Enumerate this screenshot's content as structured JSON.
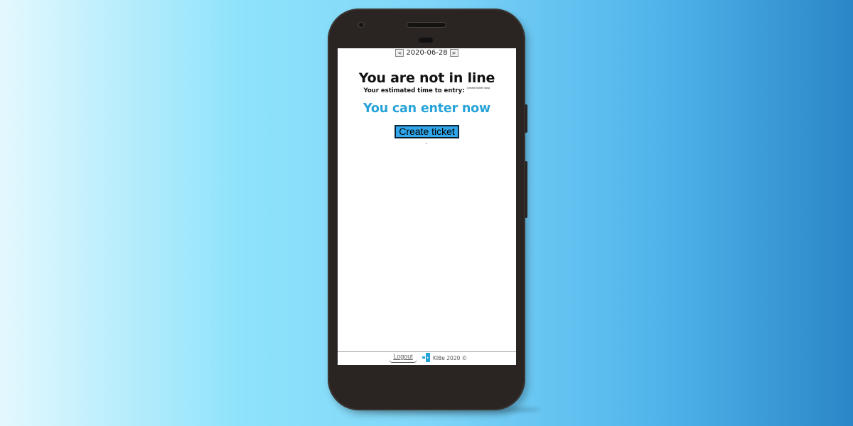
{
  "date_nav": {
    "prev_label": "<",
    "date": "2020-06-28",
    "next_label": ">"
  },
  "queue": {
    "heading": "You are not in line",
    "eta_label": "Your estimated time to entry:",
    "eta_note": "(create ticket now)",
    "status": "You can enter now",
    "create_button_label": "Create ticket"
  },
  "footer": {
    "logout_label": "Logout",
    "copyright": "KIBe 2020 ©"
  },
  "colors": {
    "accent": "#27a3d8",
    "button_bg": "#31a6ea"
  },
  "icons": {
    "logo": "door-icon"
  }
}
